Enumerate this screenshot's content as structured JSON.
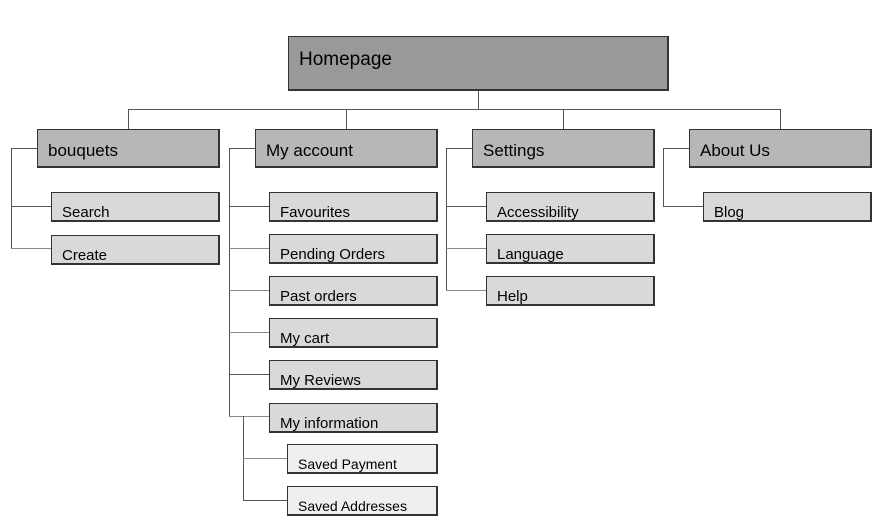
{
  "sitemap": {
    "root": {
      "label": "Homepage"
    },
    "sections": [
      {
        "label": "bouquets",
        "children": [
          {
            "label": "Search"
          },
          {
            "label": "Create"
          }
        ]
      },
      {
        "label": "My account",
        "children": [
          {
            "label": "Favourites"
          },
          {
            "label": "Pending Orders"
          },
          {
            "label": "Past orders"
          },
          {
            "label": "My cart"
          },
          {
            "label": "My Reviews"
          },
          {
            "label": "My information",
            "children": [
              {
                "label": "Saved Payment"
              },
              {
                "label": "Saved Addresses"
              }
            ]
          }
        ]
      },
      {
        "label": "Settings",
        "children": [
          {
            "label": "Accessibility"
          },
          {
            "label": "Language"
          },
          {
            "label": "Help"
          }
        ]
      },
      {
        "label": "About Us",
        "children": [
          {
            "label": "Blog"
          }
        ]
      }
    ]
  },
  "colors": {
    "root_fill": "#999999",
    "section_fill": "#b7b7b7",
    "page_fill": "#d9d9d9",
    "subpage_fill": "#efefef",
    "connector": "#555555"
  }
}
